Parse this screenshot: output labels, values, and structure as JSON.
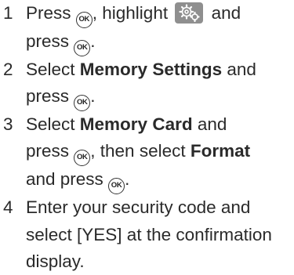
{
  "steps": [
    {
      "number": "1",
      "t1": "Press ",
      "ok1": "OK",
      "t2": ", highlight ",
      "icon": "settings-gear-icon",
      "t3": " and",
      "t4": "press ",
      "ok2": "OK",
      "t5": "."
    },
    {
      "number": "2",
      "t1": "Select ",
      "b1": "Memory Settings",
      "t2": " and",
      "t3": "press ",
      "ok1": "OK",
      "t4": "."
    },
    {
      "number": "3",
      "t1": "Select ",
      "b1": "Memory Card",
      "t2": " and",
      "t3": "press ",
      "ok1": "OK",
      "t4": ", then select ",
      "b2": "Format",
      "t5": "and press ",
      "ok2": "OK",
      "t6": "."
    },
    {
      "number": "4",
      "line1": "Enter your security code and",
      "line2": "select [YES] at the confirmation",
      "line3": "display."
    }
  ]
}
